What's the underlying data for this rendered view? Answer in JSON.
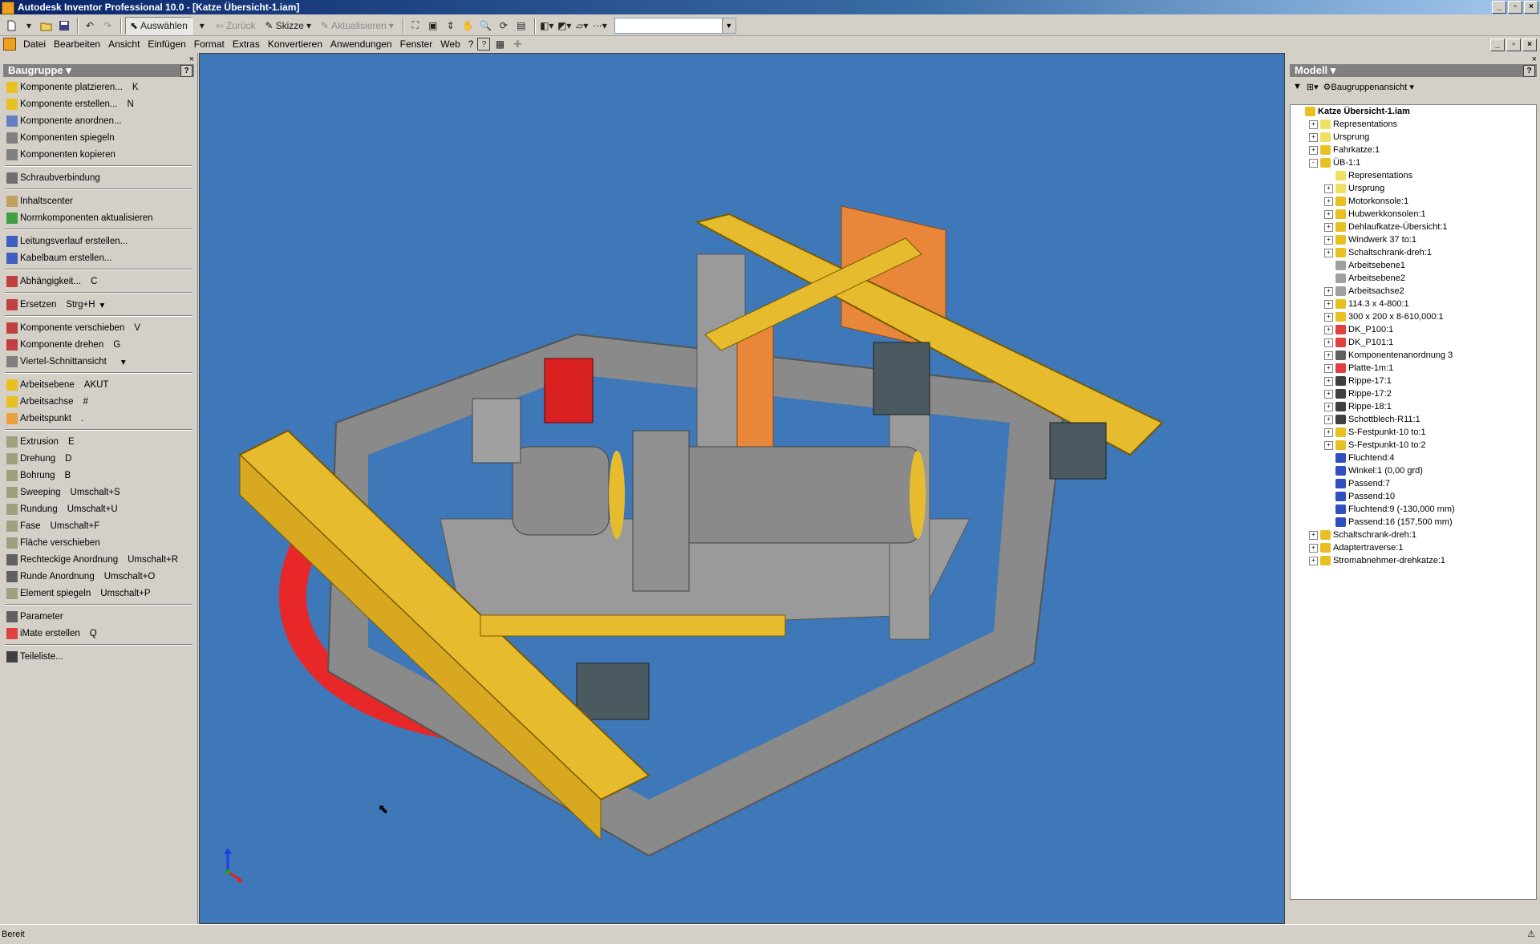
{
  "window": {
    "title": "Autodesk Inventor Professional 10.0 - [Katze Übersicht-1.iam]"
  },
  "toolbar": {
    "back_label": "Zurück",
    "select_label": "Auswählen",
    "sketch_label": "Skizze",
    "update_label": "Aktualisieren",
    "combo_value": ""
  },
  "menu": {
    "items": [
      "Datei",
      "Bearbeiten",
      "Ansicht",
      "Einfügen",
      "Format",
      "Extras",
      "Konvertieren",
      "Anwendungen",
      "Fenster",
      "Web",
      "?"
    ]
  },
  "left_panel": {
    "title": "Baugruppe",
    "commands": [
      {
        "label": "Komponente platzieren...",
        "shortcut": "K"
      },
      {
        "label": "Komponente erstellen...",
        "shortcut": "N"
      },
      {
        "label": "Komponente anordnen...",
        "shortcut": ""
      },
      {
        "label": "Komponenten spiegeln",
        "shortcut": ""
      },
      {
        "label": "Komponenten kopieren",
        "shortcut": ""
      },
      {
        "label": "Schraubverbindung",
        "shortcut": ""
      },
      {
        "label": "Inhaltscenter",
        "shortcut": ""
      },
      {
        "label": "Normkomponenten aktualisieren",
        "shortcut": ""
      },
      {
        "label": "Leitungsverlauf erstellen...",
        "shortcut": ""
      },
      {
        "label": "Kabelbaum erstellen...",
        "shortcut": ""
      },
      {
        "label": "Abhängigkeit...",
        "shortcut": "C"
      },
      {
        "label": "Ersetzen",
        "shortcut": "Strg+H"
      },
      {
        "label": "Komponente verschieben",
        "shortcut": "V"
      },
      {
        "label": "Komponente drehen",
        "shortcut": "G"
      },
      {
        "label": "Viertel-Schnittansicht",
        "shortcut": ""
      },
      {
        "label": "Arbeitsebene",
        "shortcut": "AKUT"
      },
      {
        "label": "Arbeitsachse",
        "shortcut": "#"
      },
      {
        "label": "Arbeitspunkt",
        "shortcut": "."
      },
      {
        "label": "Extrusion",
        "shortcut": "E"
      },
      {
        "label": "Drehung",
        "shortcut": "D"
      },
      {
        "label": "Bohrung",
        "shortcut": "B"
      },
      {
        "label": "Sweeping",
        "shortcut": "Umschalt+S"
      },
      {
        "label": "Rundung",
        "shortcut": "Umschalt+U"
      },
      {
        "label": "Fase",
        "shortcut": "Umschalt+F"
      },
      {
        "label": "Fläche verschieben",
        "shortcut": ""
      },
      {
        "label": "Rechteckige Anordnung",
        "shortcut": "Umschalt+R"
      },
      {
        "label": "Runde Anordnung",
        "shortcut": "Umschalt+O"
      },
      {
        "label": "Element spiegeln",
        "shortcut": "Umschalt+P"
      },
      {
        "label": "Parameter",
        "shortcut": ""
      },
      {
        "label": "iMate erstellen",
        "shortcut": "Q"
      },
      {
        "label": "Teileliste...",
        "shortcut": ""
      }
    ]
  },
  "right_panel": {
    "title": "Modell",
    "view_label": "Baugruppenansicht",
    "tree": [
      {
        "label": "Katze Übersicht-1.iam",
        "level": 0,
        "exp": "",
        "icon": "#e8c020"
      },
      {
        "label": "Representations",
        "level": 1,
        "exp": "+",
        "icon": "#f0e060"
      },
      {
        "label": "Ursprung",
        "level": 1,
        "exp": "+",
        "icon": "#f0e060"
      },
      {
        "label": "Fahrkatze:1",
        "level": 1,
        "exp": "+",
        "icon": "#e8c020"
      },
      {
        "label": "ÜB-1:1",
        "level": 1,
        "exp": "-",
        "icon": "#e8c020"
      },
      {
        "label": "Representations",
        "level": 2,
        "exp": "",
        "icon": "#f0e060"
      },
      {
        "label": "Ursprung",
        "level": 2,
        "exp": "+",
        "icon": "#f0e060"
      },
      {
        "label": "Motorkonsole:1",
        "level": 2,
        "exp": "+",
        "icon": "#e8c020"
      },
      {
        "label": "Hubwerkkonsolen:1",
        "level": 2,
        "exp": "+",
        "icon": "#e8c020"
      },
      {
        "label": "Dehlaufkatze-Übersicht:1",
        "level": 2,
        "exp": "+",
        "icon": "#e8c020"
      },
      {
        "label": "Windwerk 37 to:1",
        "level": 2,
        "exp": "+",
        "icon": "#e8c020"
      },
      {
        "label": "Schaltschrank-dreh:1",
        "level": 2,
        "exp": "+",
        "icon": "#e8c020"
      },
      {
        "label": "Arbeitsebene1",
        "level": 2,
        "exp": "",
        "icon": "#a0a0a0"
      },
      {
        "label": "Arbeitsebene2",
        "level": 2,
        "exp": "",
        "icon": "#a0a0a0"
      },
      {
        "label": "Arbeitsachse2",
        "level": 2,
        "exp": "+",
        "icon": "#a0a0a0"
      },
      {
        "label": "114.3 x 4-800:1",
        "level": 2,
        "exp": "+",
        "icon": "#e8c020"
      },
      {
        "label": "300 x 200 x 8-610,000:1",
        "level": 2,
        "exp": "+",
        "icon": "#e8c020"
      },
      {
        "label": "DK_P100:1",
        "level": 2,
        "exp": "+",
        "icon": "#e04040"
      },
      {
        "label": "DK_P101:1",
        "level": 2,
        "exp": "+",
        "icon": "#e04040"
      },
      {
        "label": "Komponentenanordnung 3",
        "level": 2,
        "exp": "+",
        "icon": "#606060"
      },
      {
        "label": "Platte-1m:1",
        "level": 2,
        "exp": "+",
        "icon": "#e04040"
      },
      {
        "label": "Rippe-17:1",
        "level": 2,
        "exp": "+",
        "icon": "#404040"
      },
      {
        "label": "Rippe-17:2",
        "level": 2,
        "exp": "+",
        "icon": "#404040"
      },
      {
        "label": "Rippe-18:1",
        "level": 2,
        "exp": "+",
        "icon": "#404040"
      },
      {
        "label": "Schottblech-R11:1",
        "level": 2,
        "exp": "+",
        "icon": "#404040"
      },
      {
        "label": "S-Festpunkt-10 to:1",
        "level": 2,
        "exp": "+",
        "icon": "#e8c020"
      },
      {
        "label": "S-Festpunkt-10 to:2",
        "level": 2,
        "exp": "+",
        "icon": "#e8c020"
      },
      {
        "label": "Fluchtend:4",
        "level": 2,
        "exp": "",
        "icon": "#3050c0"
      },
      {
        "label": "Winkel:1 (0,00 grd)",
        "level": 2,
        "exp": "",
        "icon": "#3050c0"
      },
      {
        "label": "Passend:7",
        "level": 2,
        "exp": "",
        "icon": "#3050c0"
      },
      {
        "label": "Passend:10",
        "level": 2,
        "exp": "",
        "icon": "#3050c0"
      },
      {
        "label": "Fluchtend:9 (-130,000 mm)",
        "level": 2,
        "exp": "",
        "icon": "#3050c0"
      },
      {
        "label": "Passend:16 (157,500 mm)",
        "level": 2,
        "exp": "",
        "icon": "#3050c0"
      },
      {
        "label": "Schaltschrank-dreh:1",
        "level": 1,
        "exp": "+",
        "icon": "#e8c020"
      },
      {
        "label": "Adaptertraverse:1",
        "level": 1,
        "exp": "+",
        "icon": "#e8c020"
      },
      {
        "label": "Stromabnehmer-drehkatze:1",
        "level": 1,
        "exp": "+",
        "icon": "#e8c020"
      }
    ]
  },
  "status": {
    "text": "Bereit"
  },
  "colors": {
    "viewport_bg": "#3e78b8",
    "beam_yellow": "#e6bc2e",
    "frame_gray": "#9a9a9a",
    "rail_red": "#e82828",
    "orange": "#e8863a"
  }
}
